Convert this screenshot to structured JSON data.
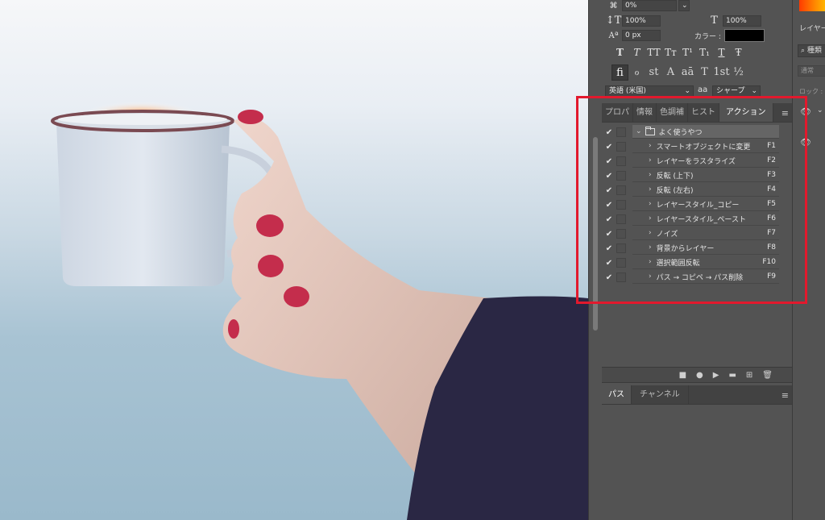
{
  "character_panel": {
    "tracking_value": "0%",
    "vertical_scale": "100%",
    "horizontal_scale": "100%",
    "baseline_shift": "0 px",
    "color_label": "カラー :",
    "color_value": "#000000",
    "type_buttons": [
      "T",
      "T",
      "TT",
      "Tт",
      "T¹",
      "T₁",
      "T",
      "Ŧ"
    ],
    "opentype_buttons": [
      "fi",
      "ℴ",
      "st",
      "A",
      "aā",
      "T",
      "1st",
      "½"
    ],
    "language": "英語 (米国)",
    "aa_label": "aa",
    "antialias": "シャープ"
  },
  "tabs": [
    {
      "label": "プロパ"
    },
    {
      "label": "情報"
    },
    {
      "label": "色調補"
    },
    {
      "label": "ヒスト"
    },
    {
      "label": "アクション"
    }
  ],
  "actions": {
    "set_name": "よく使うやつ",
    "items": [
      {
        "name": "スマートオブジェクトに変更",
        "key": "F1"
      },
      {
        "name": "レイヤーをラスタライズ",
        "key": "F2"
      },
      {
        "name": "反転 (上下)",
        "key": "F3"
      },
      {
        "name": "反転 (左右)",
        "key": "F4"
      },
      {
        "name": "レイヤースタイル_コピー",
        "key": "F5"
      },
      {
        "name": "レイヤースタイル_ペースト",
        "key": "F6"
      },
      {
        "name": "ノイズ",
        "key": "F7"
      },
      {
        "name": "背景からレイヤー",
        "key": "F8"
      },
      {
        "name": "選択範囲反転",
        "key": "F10"
      },
      {
        "name": "パス → コピペ → パス削除",
        "key": "F9"
      }
    ]
  },
  "action_toolbar": [
    "■",
    "●",
    "▶",
    "▬",
    "⊞",
    "🗑"
  ],
  "bottom_tabs": [
    {
      "label": "パス"
    },
    {
      "label": "チャンネル"
    }
  ],
  "right_panel": {
    "layers_tab": "レイヤー",
    "search_label": "種類",
    "blend_mode": "通常",
    "lock_label": "ロック :"
  },
  "colors": {
    "highlight": "#e2192d",
    "panel_bg": "#535353"
  }
}
